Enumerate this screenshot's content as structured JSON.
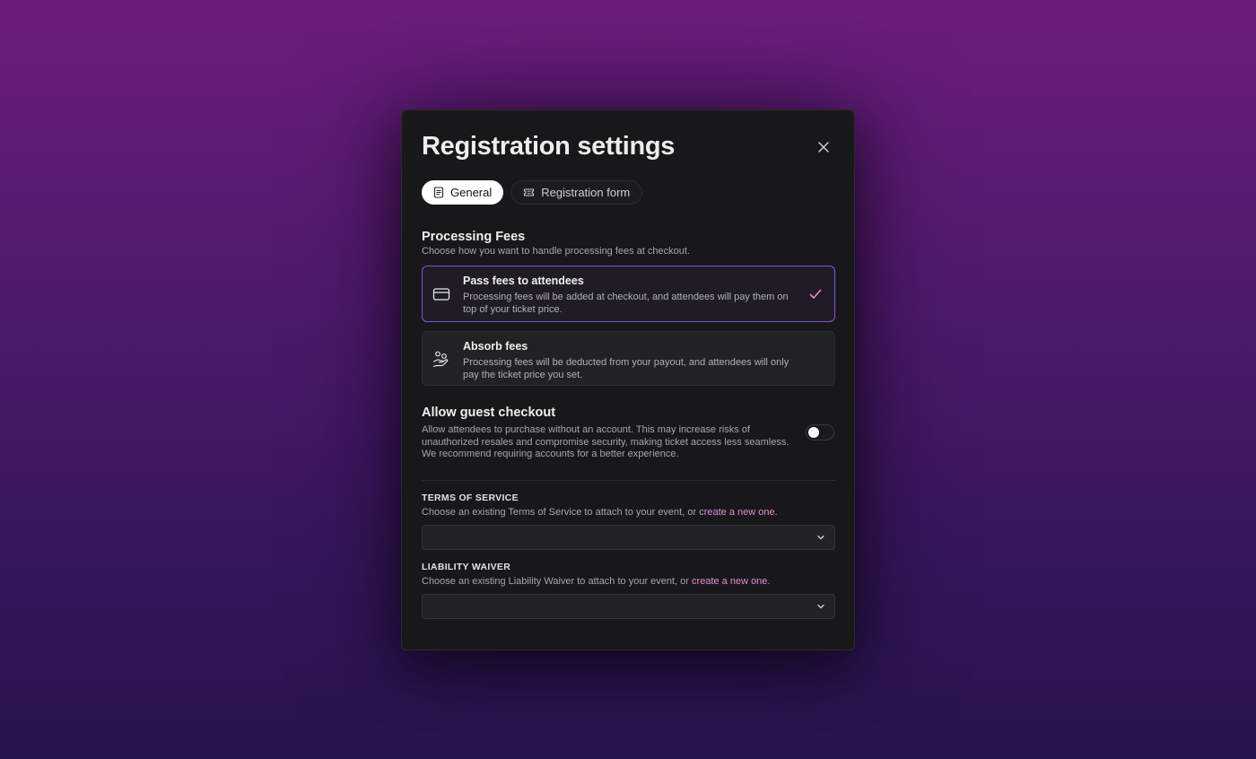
{
  "modal": {
    "title": "Registration settings"
  },
  "tabs": [
    {
      "label": "General",
      "active": true,
      "icon": "document-icon"
    },
    {
      "label": "Registration form",
      "active": false,
      "icon": "ticket-icon"
    }
  ],
  "processing_fees": {
    "title": "Processing Fees",
    "description": "Choose how you want to handle processing fees at checkout.",
    "options": [
      {
        "title": "Pass fees to attendees",
        "description": "Processing fees will be added at checkout, and attendees will pay them on top of your ticket price.",
        "icon": "credit-card-icon",
        "selected": true
      },
      {
        "title": "Absorb fees",
        "description": "Processing fees will be deducted from your payout, and attendees will only pay the ticket price you set.",
        "icon": "hand-coins-icon",
        "selected": false
      }
    ]
  },
  "guest_checkout": {
    "title": "Allow guest checkout",
    "description": "Allow attendees to purchase without an account. This may increase risks of unauthorized resales and compromise security, making ticket access less seamless. We recommend requiring accounts for a better experience.",
    "enabled": false
  },
  "terms": {
    "label": "TERMS OF SERVICE",
    "desc_prefix": "Choose an existing Terms of Service to attach to your event, or ",
    "link": "create a new one",
    "desc_suffix": ".",
    "value": ""
  },
  "waiver": {
    "label": "LIABILITY WAIVER",
    "desc_prefix": "Choose an existing Liability Waiver to attach to your event, or ",
    "link": "create a new one",
    "desc_suffix": ".",
    "value": ""
  },
  "colors": {
    "accent_border": "#8a4fd6",
    "link": "#e58bd5",
    "check": "#e58bd5"
  }
}
